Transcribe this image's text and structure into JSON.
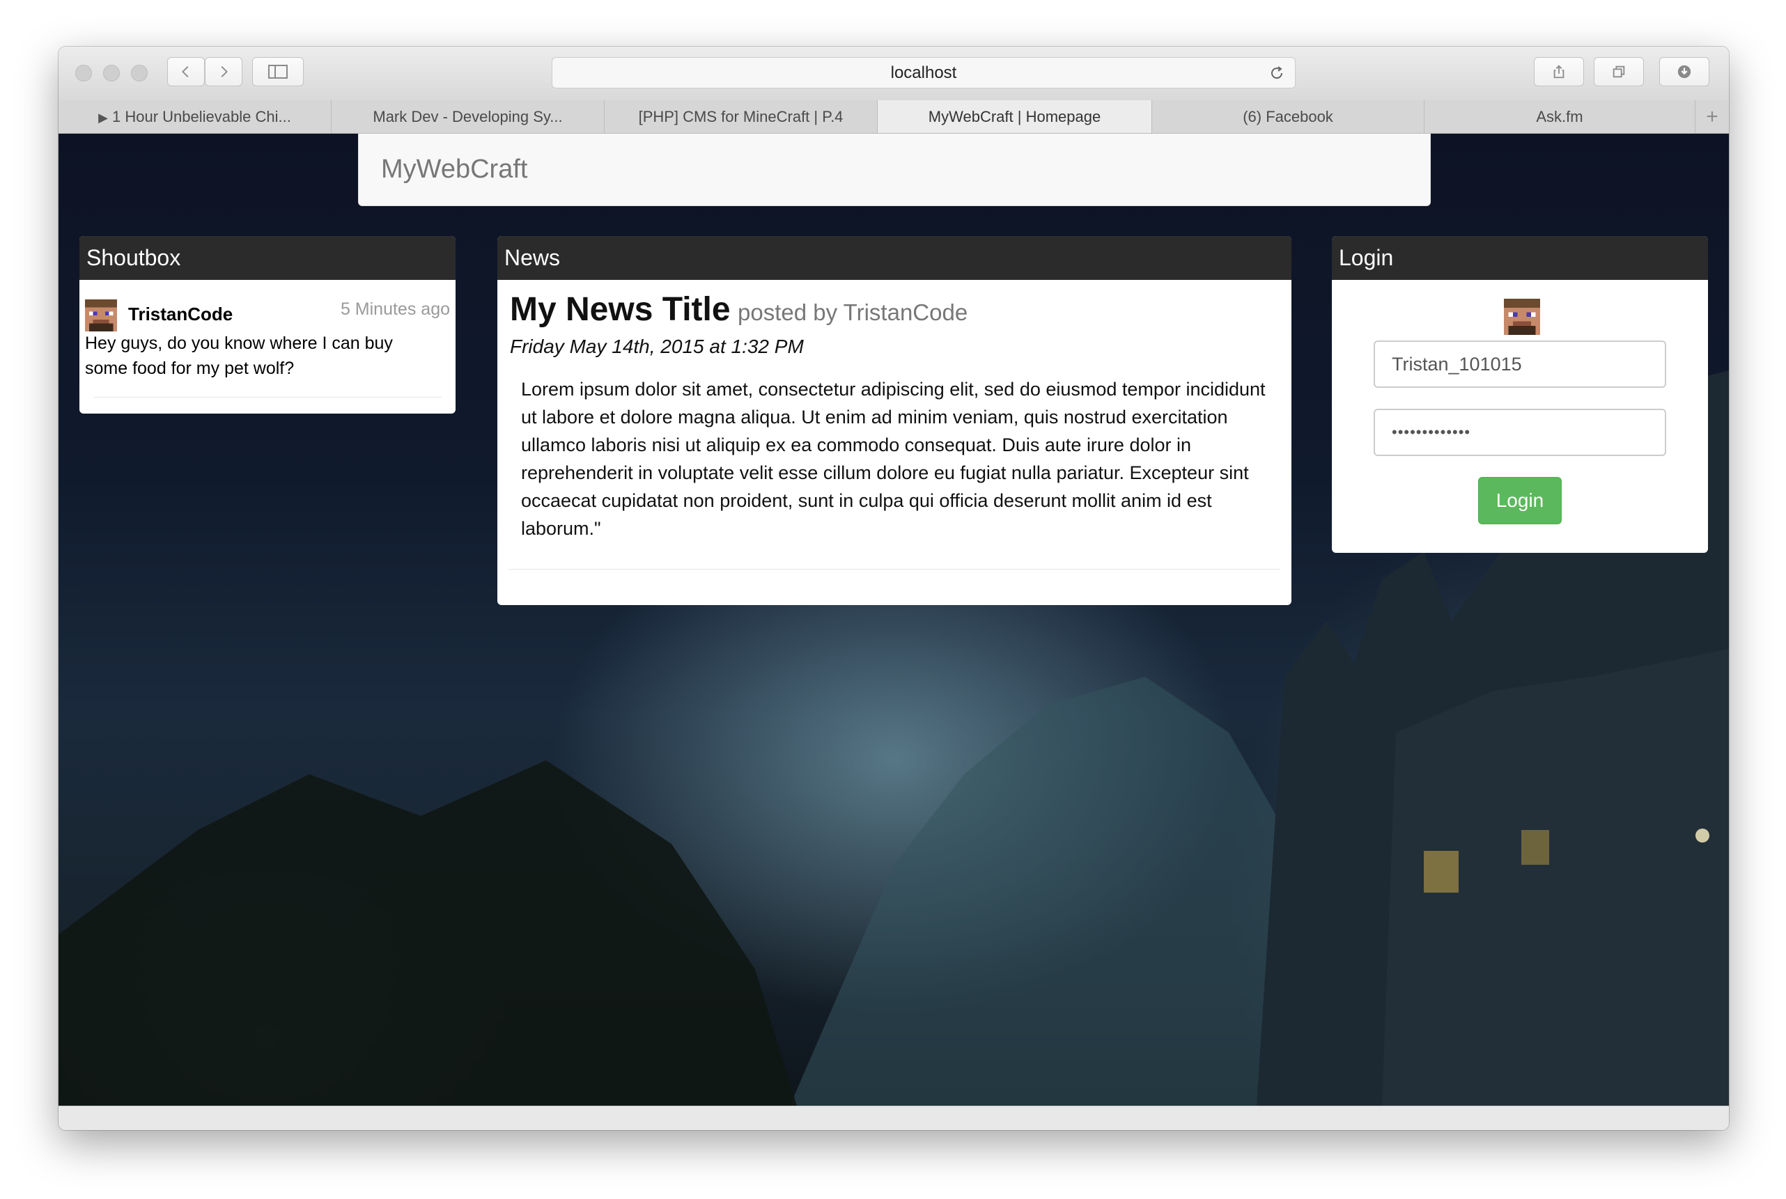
{
  "browser": {
    "url": "localhost",
    "tabs": [
      {
        "label": "1 Hour Unbelievable Chi...",
        "playing": true
      },
      {
        "label": "Mark Dev - Developing Sy..."
      },
      {
        "label": "[PHP] CMS for MineCraft | P.4"
      },
      {
        "label": "MyWebCraft | Homepage",
        "active": true
      },
      {
        "label": "(6) Facebook"
      },
      {
        "label": "Ask.fm"
      }
    ],
    "add_tab": "+"
  },
  "site": {
    "brand": "MyWebCraft"
  },
  "shoutbox": {
    "title": "Shoutbox",
    "entries": [
      {
        "user": "TristanCode",
        "time": "5 Minutes ago",
        "message": "Hey guys, do you know where I can buy some food for my pet wolf?"
      }
    ]
  },
  "news": {
    "title": "News",
    "post": {
      "headline": "My News Title",
      "byline": "posted by TristanCode",
      "date": "Friday May 14th, 2015 at 1:32 PM",
      "body": "Lorem ipsum dolor sit amet, consectetur adipiscing elit, sed do eiusmod tempor incididunt ut labore et dolore magna aliqua. Ut enim ad minim veniam, quis nostrud exercitation ullamco laboris nisi ut aliquip ex ea commodo consequat. Duis aute irure dolor in reprehenderit in voluptate velit esse cillum dolore eu fugiat nulla pariatur. Excepteur sint occaecat cupidatat non proident, sunt in culpa qui officia deserunt mollit anim id est laborum.\""
    }
  },
  "login": {
    "title": "Login",
    "username": "Tristan_101015",
    "password_mask": "•••••••••••••",
    "button": "Login"
  },
  "colors": {
    "panel_header": "#2b2b2b",
    "login_button": "#5cb85c"
  }
}
